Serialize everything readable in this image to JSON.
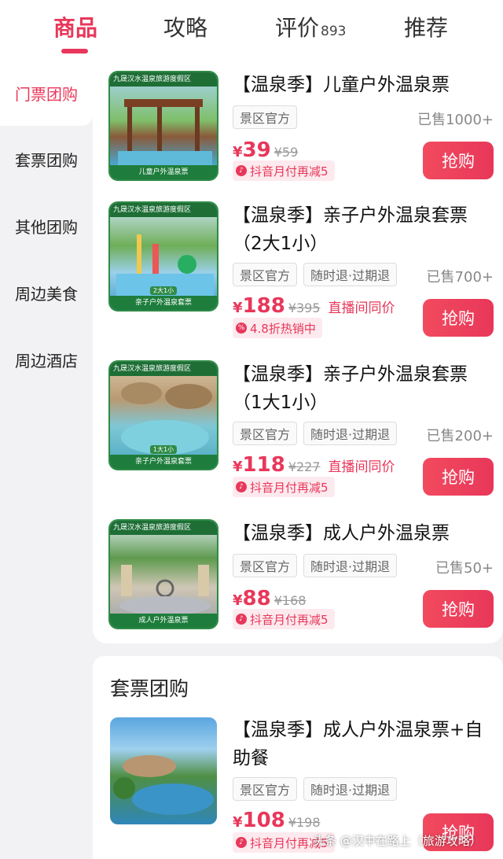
{
  "tabs": [
    {
      "label": "商品"
    },
    {
      "label": "攻略"
    },
    {
      "label": "评价",
      "count": "893"
    },
    {
      "label": "推荐"
    }
  ],
  "sidebar": {
    "items": [
      {
        "label": "门票团购"
      },
      {
        "label": "套票团购"
      },
      {
        "label": "其他团购"
      },
      {
        "label": "周边美食"
      },
      {
        "label": "周边酒店"
      }
    ]
  },
  "products": [
    {
      "thumb_banner": "九晟汉水温泉旅游度假区",
      "thumb_caption": "儿童户外温泉票",
      "title": "【温泉季】儿童户外温泉票",
      "tags": [
        "景区官方"
      ],
      "sold": "已售1000+",
      "currency": "¥",
      "price": "39",
      "original": "¥59",
      "live": "",
      "promo": "抖音月付再减5",
      "button": "抢购"
    },
    {
      "thumb_banner": "九晟汉水温泉旅游度假区",
      "thumb_caption": "亲子户外温泉套票",
      "thumb_sub": "2大1小",
      "title": "【温泉季】亲子户外温泉套票（2大1小）",
      "tags": [
        "景区官方",
        "随时退·过期退"
      ],
      "sold": "已售700+",
      "currency": "¥",
      "price": "188",
      "original": "¥395",
      "live": "直播间同价",
      "promo": "4.8折热销中",
      "button": "抢购"
    },
    {
      "thumb_banner": "九晟汉水温泉旅游度假区",
      "thumb_caption": "亲子户外温泉套票",
      "thumb_sub": "1大1小",
      "title": "【温泉季】亲子户外温泉套票（1大1小）",
      "tags": [
        "景区官方",
        "随时退·过期退"
      ],
      "sold": "已售200+",
      "currency": "¥",
      "price": "118",
      "original": "¥227",
      "live": "直播间同价",
      "promo": "抖音月付再减5",
      "button": "抢购"
    },
    {
      "thumb_banner": "九晟汉水温泉旅游度假区",
      "thumb_caption": "成人户外温泉票",
      "title": "【温泉季】成人户外温泉票",
      "tags": [
        "景区官方",
        "随时退·过期退"
      ],
      "sold": "已售50+",
      "currency": "¥",
      "price": "88",
      "original": "¥168",
      "live": "",
      "promo": "抖音月付再减5",
      "button": "抢购"
    }
  ],
  "section2": {
    "title": "套票团购",
    "product": {
      "title": "【温泉季】成人户外温泉票+自助餐",
      "tags": [
        "景区官方",
        "随时退·过期退"
      ],
      "currency": "¥",
      "price": "108",
      "original": "¥198",
      "promo": "抖音月付再减5",
      "button": "抢购"
    }
  },
  "watermark": "头条 @汉中在路上（旅游攻略）",
  "colors": {
    "accent": "#e8375a",
    "thumb_green": "#1e6e36"
  }
}
